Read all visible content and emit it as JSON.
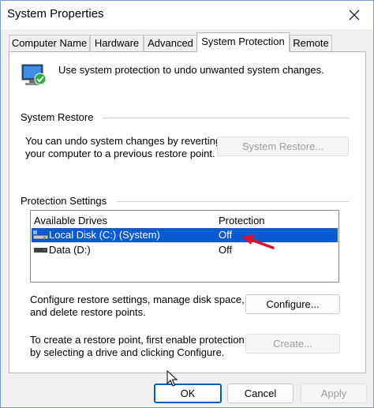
{
  "window": {
    "title": "System Properties"
  },
  "tabs": [
    {
      "label": "Computer Name"
    },
    {
      "label": "Hardware"
    },
    {
      "label": "Advanced"
    },
    {
      "label": "System Protection"
    },
    {
      "label": "Remote"
    }
  ],
  "header": {
    "text": "Use system protection to undo unwanted system changes."
  },
  "system_restore": {
    "title": "System Restore",
    "description_line1": "You can undo system changes by reverting",
    "description_line2": "your computer to a previous restore point.",
    "button_label": "System Restore..."
  },
  "protection": {
    "title": "Protection Settings",
    "columns": {
      "drives": "Available Drives",
      "protection": "Protection"
    },
    "drives": [
      {
        "name": "Local Disk (C:) (System)",
        "status": "Off",
        "selected": true
      },
      {
        "name": "Data (D:)",
        "status": "Off",
        "selected": false
      }
    ],
    "configure_text_line1": "Configure restore settings, manage disk space,",
    "configure_text_line2": "and delete restore points.",
    "configure_label": "Configure...",
    "create_text_line1": "To create a restore point, first enable protection",
    "create_text_line2": "by selecting a drive and clicking Configure.",
    "create_label": "Create..."
  },
  "footer": {
    "ok_label": "OK",
    "cancel_label": "Cancel",
    "apply_label": "Apply"
  },
  "colors": {
    "selection": "#0a5ad2",
    "arrow": "#e0102a"
  }
}
